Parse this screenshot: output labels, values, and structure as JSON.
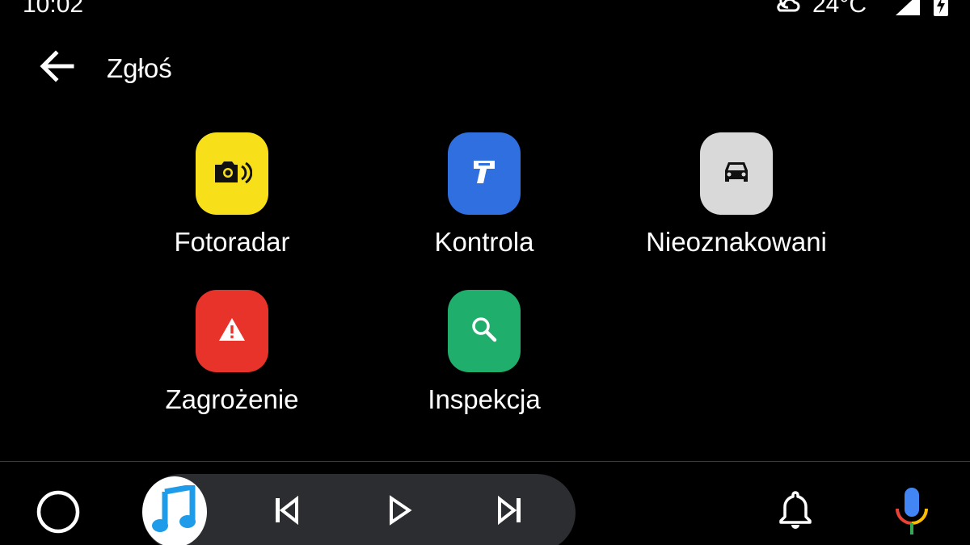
{
  "status_bar": {
    "time": "10:02",
    "temperature": "24°C",
    "weather_icon": "cloudy-night-icon",
    "signal_icon": "signal-icon",
    "battery_icon": "battery-charging-icon"
  },
  "header": {
    "back_icon": "arrow-back-icon",
    "title": "Zgłoś"
  },
  "tiles": [
    {
      "label": "Fotoradar",
      "icon": "speed-camera-icon",
      "color": "#f7e01a"
    },
    {
      "label": "Kontrola",
      "icon": "radar-gun-icon",
      "color": "#2f6fe0"
    },
    {
      "label": "Nieoznakowani",
      "icon": "car-icon",
      "color": "#d9d9d9"
    },
    {
      "label": "Zagrożenie",
      "icon": "warning-icon",
      "color": "#e8332b"
    },
    {
      "label": "Inspekcja",
      "icon": "search-icon",
      "color": "#1fae6b"
    }
  ],
  "bottom_nav": {
    "home_icon": "home-circle-icon",
    "media_app_icon": "music-note-icon",
    "previous_icon": "skip-previous-icon",
    "play_icon": "play-icon",
    "next_icon": "skip-next-icon",
    "notifications_icon": "bell-icon",
    "assistant_icon": "microphone-icon"
  }
}
